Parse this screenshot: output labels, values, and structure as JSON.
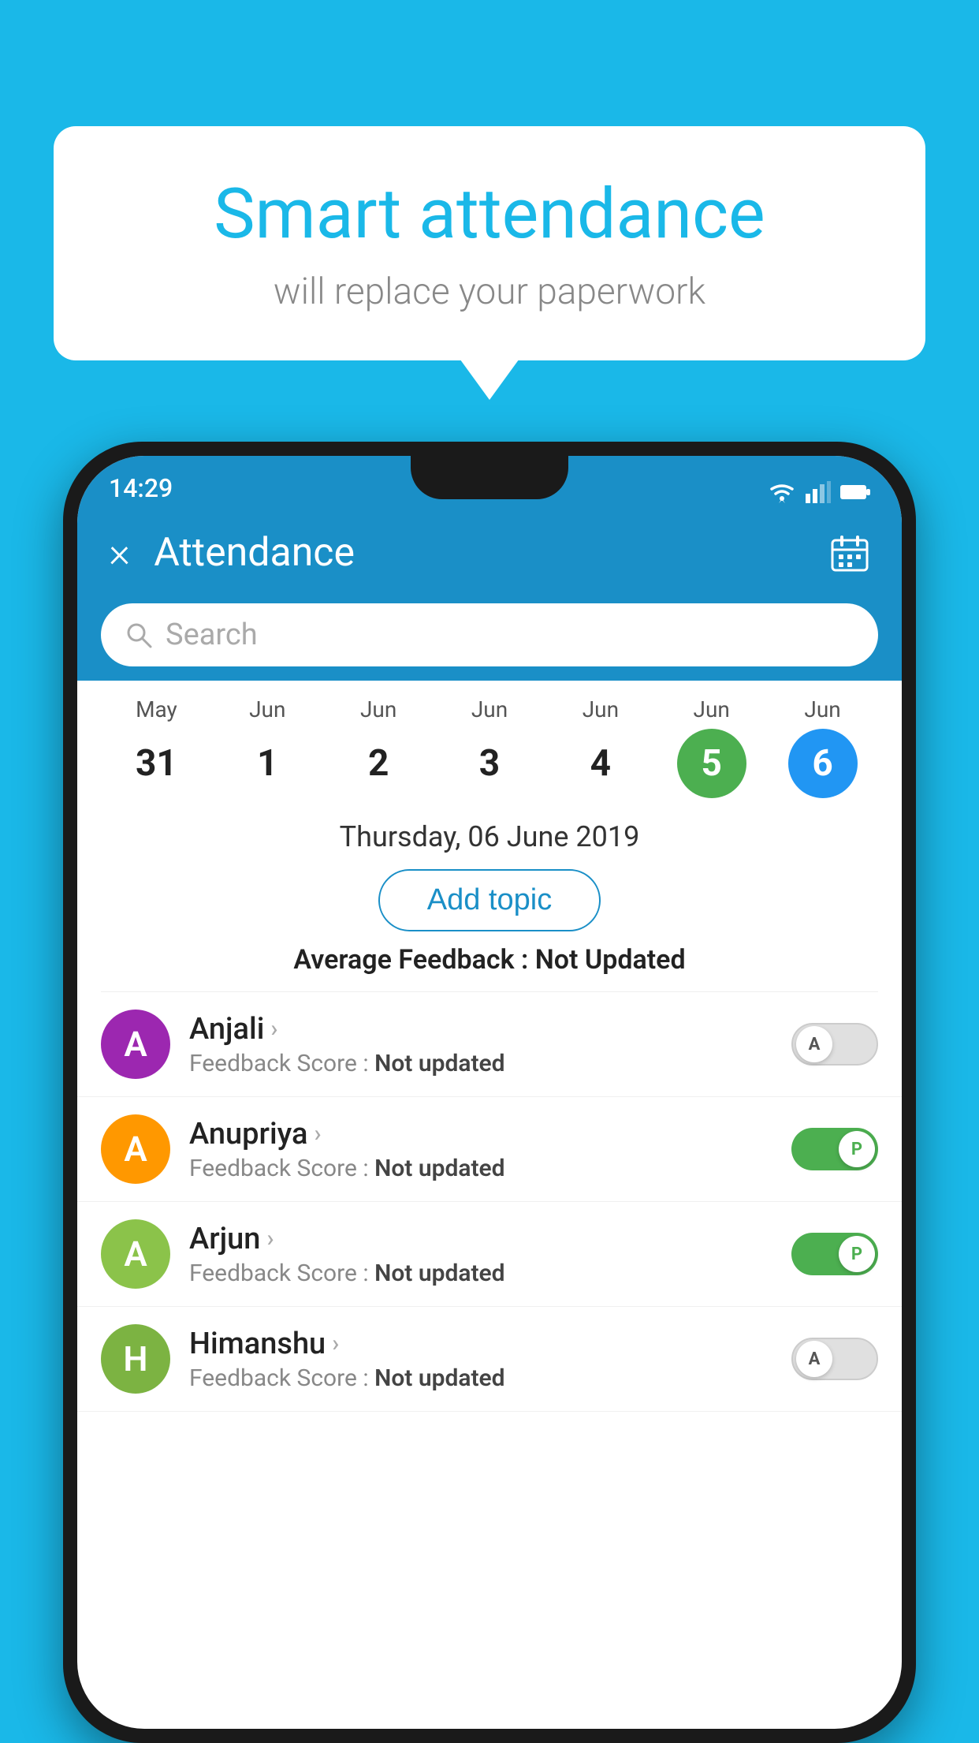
{
  "background_color": "#1ab8e8",
  "bubble": {
    "title": "Smart attendance",
    "subtitle": "will replace your paperwork"
  },
  "status_bar": {
    "time": "14:29"
  },
  "app_bar": {
    "title": "Attendance",
    "close_label": "×"
  },
  "search": {
    "placeholder": "Search"
  },
  "calendar": {
    "days": [
      {
        "month": "May",
        "date": "31",
        "selected": ""
      },
      {
        "month": "Jun",
        "date": "1",
        "selected": ""
      },
      {
        "month": "Jun",
        "date": "2",
        "selected": ""
      },
      {
        "month": "Jun",
        "date": "3",
        "selected": ""
      },
      {
        "month": "Jun",
        "date": "4",
        "selected": ""
      },
      {
        "month": "Jun",
        "date": "5",
        "selected": "green"
      },
      {
        "month": "Jun",
        "date": "6",
        "selected": "blue"
      }
    ],
    "selected_date": "Thursday, 06 June 2019"
  },
  "add_topic_label": "Add topic",
  "avg_feedback": {
    "label": "Average Feedback : ",
    "value": "Not Updated"
  },
  "students": [
    {
      "name": "Anjali",
      "avatar_letter": "A",
      "avatar_color": "purple",
      "feedback_label": "Feedback Score : ",
      "feedback_value": "Not updated",
      "toggle_state": "off",
      "toggle_label": "A"
    },
    {
      "name": "Anupriya",
      "avatar_letter": "A",
      "avatar_color": "orange",
      "feedback_label": "Feedback Score : ",
      "feedback_value": "Not updated",
      "toggle_state": "on",
      "toggle_label": "P"
    },
    {
      "name": "Arjun",
      "avatar_letter": "A",
      "avatar_color": "lightgreen",
      "feedback_label": "Feedback Score : ",
      "feedback_value": "Not updated",
      "toggle_state": "on",
      "toggle_label": "P"
    },
    {
      "name": "Himanshu",
      "avatar_letter": "H",
      "avatar_color": "teal",
      "feedback_label": "Feedback Score : ",
      "feedback_value": "Not updated",
      "toggle_state": "off",
      "toggle_label": "A"
    }
  ]
}
